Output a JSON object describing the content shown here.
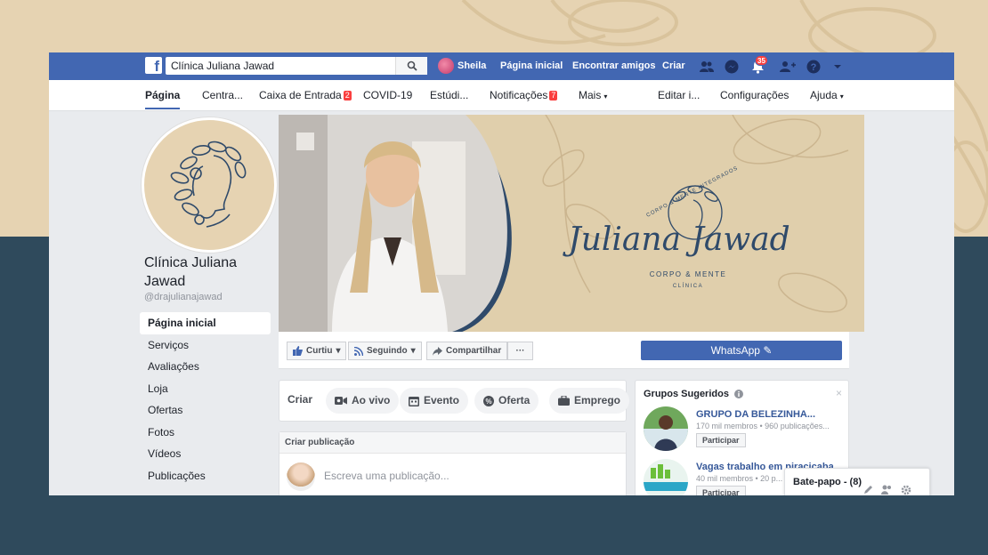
{
  "colors": {
    "fb_blue": "#4267b2",
    "link_blue": "#365899",
    "badge_red": "#fa3e3e",
    "beige": "#e6d3b2",
    "navy": "#2f4a5c"
  },
  "topbar": {
    "logo_icon": "facebook-f-icon",
    "search_value": "Clínica Juliana Jawad",
    "user_name": "Sheila",
    "links": [
      "Página inicial",
      "Encontrar amigos",
      "Criar"
    ],
    "notifications_count": "35"
  },
  "page_tabs": [
    {
      "label": "Página",
      "badge": ""
    },
    {
      "label": "Centra...",
      "badge": ""
    },
    {
      "label": "Caixa de Entrada",
      "badge": "2"
    },
    {
      "label": "COVID-19",
      "badge": ""
    },
    {
      "label": "Estúdi...",
      "badge": ""
    },
    {
      "label": "Notificações",
      "badge": "7"
    },
    {
      "label": "Mais",
      "badge": ""
    },
    {
      "label": "Editar i...",
      "badge": ""
    },
    {
      "label": "Configurações",
      "badge": ""
    },
    {
      "label": "Ajuda",
      "badge": ""
    }
  ],
  "profile": {
    "name": "Clínica Juliana Jawad",
    "handle": "@drajulianajawad"
  },
  "left_nav": [
    "Página inicial",
    "Serviços",
    "Avaliações",
    "Loja",
    "Ofertas",
    "Fotos",
    "Vídeos",
    "Publicações"
  ],
  "cover": {
    "brand": "Juliana Jawad",
    "arc_text": "CORPO & MENTE INTEGRADOS",
    "subtitle": "CORPO & MENTE",
    "subtitle2": "CLÍNICA"
  },
  "actions": {
    "like": "Curtiu",
    "follow": "Seguindo",
    "share": "Compartilhar",
    "more": "···",
    "whatsapp": "WhatsApp"
  },
  "create": {
    "label": "Criar",
    "pills": [
      "Ao vivo",
      "Evento",
      "Oferta",
      "Emprego"
    ]
  },
  "composer": {
    "header": "Criar publicação",
    "placeholder": "Escreva uma publicação..."
  },
  "groups": {
    "title": "Grupos Sugeridos",
    "close": "×",
    "items": [
      {
        "name": "GRUPO DA BELEZINHA...",
        "meta": "170 mil membros • 960 publicações...",
        "join": "Participar"
      },
      {
        "name": "Vagas trabalho em piracicaba",
        "meta": "40 mil membros • 20 p...",
        "join": "Participar"
      }
    ]
  },
  "chat": {
    "label": "Bate-papo - (8)"
  }
}
